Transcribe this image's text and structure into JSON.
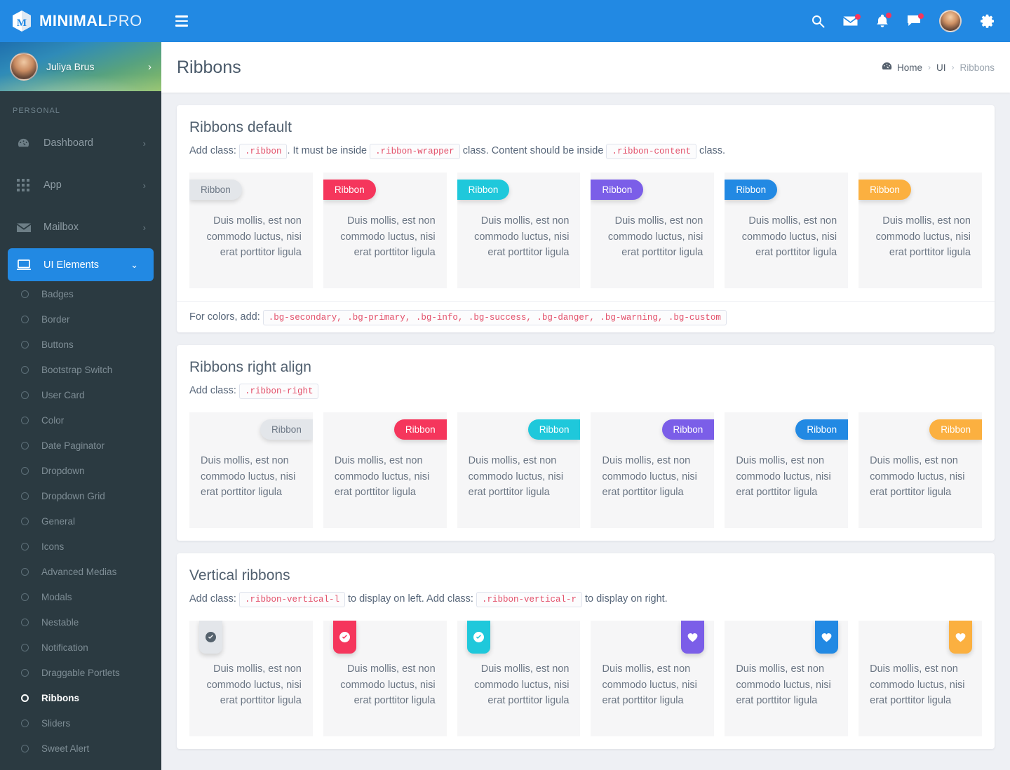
{
  "brand": {
    "bold": "MINIMAL",
    "light": "PRO",
    "logo_icon": "hexagon-m-logo-icon"
  },
  "profile": {
    "name": "Juliya Brus",
    "arrow": "›",
    "avatar_icon": "user-avatar"
  },
  "sidebar": {
    "section_title": "PERSONAL",
    "items": [
      {
        "label": "Dashboard",
        "icon": "gauge-icon",
        "caret": "›"
      },
      {
        "label": "App",
        "icon": "grid-apps-icon",
        "caret": "›"
      },
      {
        "label": "Mailbox",
        "icon": "envelope-icon",
        "caret": "›"
      },
      {
        "label": "UI Elements",
        "icon": "monitor-icon",
        "caret": "⌄",
        "active": true
      }
    ],
    "sub_items": [
      {
        "label": "Badges"
      },
      {
        "label": "Border"
      },
      {
        "label": "Buttons"
      },
      {
        "label": "Bootstrap Switch"
      },
      {
        "label": "User Card"
      },
      {
        "label": "Color"
      },
      {
        "label": "Date Paginator"
      },
      {
        "label": "Dropdown"
      },
      {
        "label": "Dropdown Grid"
      },
      {
        "label": "General"
      },
      {
        "label": "Icons"
      },
      {
        "label": "Advanced Medias"
      },
      {
        "label": "Modals"
      },
      {
        "label": "Nestable"
      },
      {
        "label": "Notification"
      },
      {
        "label": "Draggable Portlets"
      },
      {
        "label": "Ribbons",
        "current": true
      },
      {
        "label": "Sliders"
      },
      {
        "label": "Sweet Alert"
      }
    ]
  },
  "topbar": {
    "menu_icon": "hamburger-menu-icon",
    "icons": [
      {
        "name": "search-icon",
        "badge": false
      },
      {
        "name": "envelope-icon",
        "badge": true
      },
      {
        "name": "bell-icon",
        "badge": true
      },
      {
        "name": "chat-bubble-icon",
        "badge": true
      }
    ],
    "avatar_icon": "user-avatar",
    "settings_icon": "gear-icon"
  },
  "page": {
    "title": "Ribbons",
    "breadcrumb": {
      "home": "Home",
      "home_icon": "dashboard-home-icon",
      "sep": "›",
      "middle": "UI",
      "current": "Ribbons"
    }
  },
  "ribbon_text": "Duis mollis, est non commodo luctus, nisi erat porttitor ligula",
  "ribbon_label": "Ribbon",
  "cards": [
    {
      "title": "Ribbons default",
      "desc_prefix": "Add class:",
      "code1": ".ribbon",
      "desc_mid1": ". It must be inside",
      "code2": ".ribbon-wrapper",
      "desc_mid2": "class. Content should be inside",
      "code3": ".ribbon-content",
      "desc_suffix": "class.",
      "footer_label": "For colors, add:",
      "footer_code": ".bg-secondary, .bg-primary, .bg-info, .bg-success, .bg-danger, .bg-warning, .bg-custom"
    },
    {
      "title": "Ribbons right align",
      "desc_prefix": "Add class:",
      "code1": ".ribbon-right"
    },
    {
      "title": "Vertical ribbons",
      "desc_prefix": "Add class:",
      "code1": ".ribbon-vertical-l",
      "desc_mid1": "to display on left. Add class:",
      "code2": ".ribbon-vertical-r",
      "desc_suffix": "to display on right."
    }
  ],
  "colors": {
    "secondary": "#e3e6ea",
    "primary": "#f5365c",
    "info": "#1fc8db",
    "success": "#7b5ee8",
    "danger": "#2289e3",
    "warning": "#fbb040",
    "custom": "#fbb040",
    "brand_blue": "#2289e3",
    "sidebar_bg": "#2b3a41"
  },
  "vertical_icons": [
    "check-circle-icon",
    "check-circle-icon",
    "check-circle-icon",
    "heart-icon",
    "heart-icon",
    "heart-icon"
  ]
}
